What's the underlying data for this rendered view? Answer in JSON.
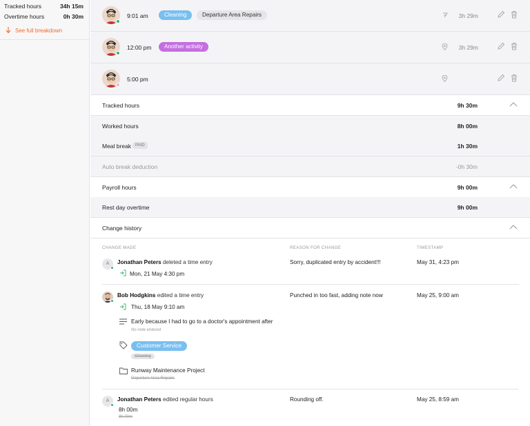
{
  "sidebar": {
    "tracked_label": "Tracked hours",
    "tracked_value": "34h 15m",
    "overtime_label": "Overtime hours",
    "overtime_value": "0h 30m",
    "breakdown_link": "See full breakdown"
  },
  "entries": [
    {
      "time": "9:01 am",
      "tags": [
        "Cleaning",
        "Departure Area Repairs"
      ],
      "duration": "3h 29m"
    },
    {
      "time": "12:00 pm",
      "tags": [
        "Another activity"
      ],
      "duration": "3h 29m"
    },
    {
      "time": "5:00 pm",
      "tags": [],
      "duration": ""
    }
  ],
  "summary": {
    "tracked": {
      "label": "Tracked hours",
      "value": "9h 30m"
    },
    "worked": {
      "label": "Worked hours",
      "value": "8h 00m"
    },
    "meal": {
      "label": "Meal break",
      "badge": "PAID",
      "value": "1h 30m"
    },
    "auto": {
      "label": "Auto break deduction",
      "value": "-0h 30m"
    },
    "payroll": {
      "label": "Payroll hours",
      "value": "9h 00m"
    },
    "restday": {
      "label": "Rest day overtime",
      "value": "9h 00m"
    }
  },
  "history": {
    "title": "Change history",
    "col_change": "CHANGE MADE",
    "col_reason": "REASON FOR CHANGE",
    "col_timestamp": "TIMESTAMP",
    "items": [
      {
        "avatar_letter": "A",
        "name": "Jonathan Peters",
        "action": "deleted a time entry",
        "entry": "Mon, 21 May 4:30 pm",
        "reason": "Sorry, duplicated entry by accident!!!",
        "timestamp": "May 31, 4:23 pm"
      },
      {
        "name": "Bob Hodgkins",
        "action": "edited a time entry",
        "entry": "Thu, 18 May 9:10 am",
        "note": "Early because I had to go to a doctor's appointment after",
        "note_old": "No note entered",
        "tag_new": "Customer Service",
        "tag_old": "Cleaning",
        "project_new": "Runway Maintenance Project",
        "project_old": "Departure Area Repairs",
        "reason": "Punched in too fast, adding note now",
        "timestamp": "May 25, 9:00 am"
      },
      {
        "avatar_letter": "A",
        "name": "Jonathan Peters",
        "action": "edited regular hours",
        "hours_new": "8h 00m",
        "hours_old": "8h 00m",
        "reason": "Rounding off.",
        "timestamp": "May 25, 8:59 am"
      }
    ]
  },
  "colors": {
    "accent_orange": "#ef6c2b",
    "cleaning_pill": "#79bff0",
    "activity_pill": "#c46ee0",
    "customer_service_pill": "#79bff0",
    "online_dot": "#3cb371"
  }
}
